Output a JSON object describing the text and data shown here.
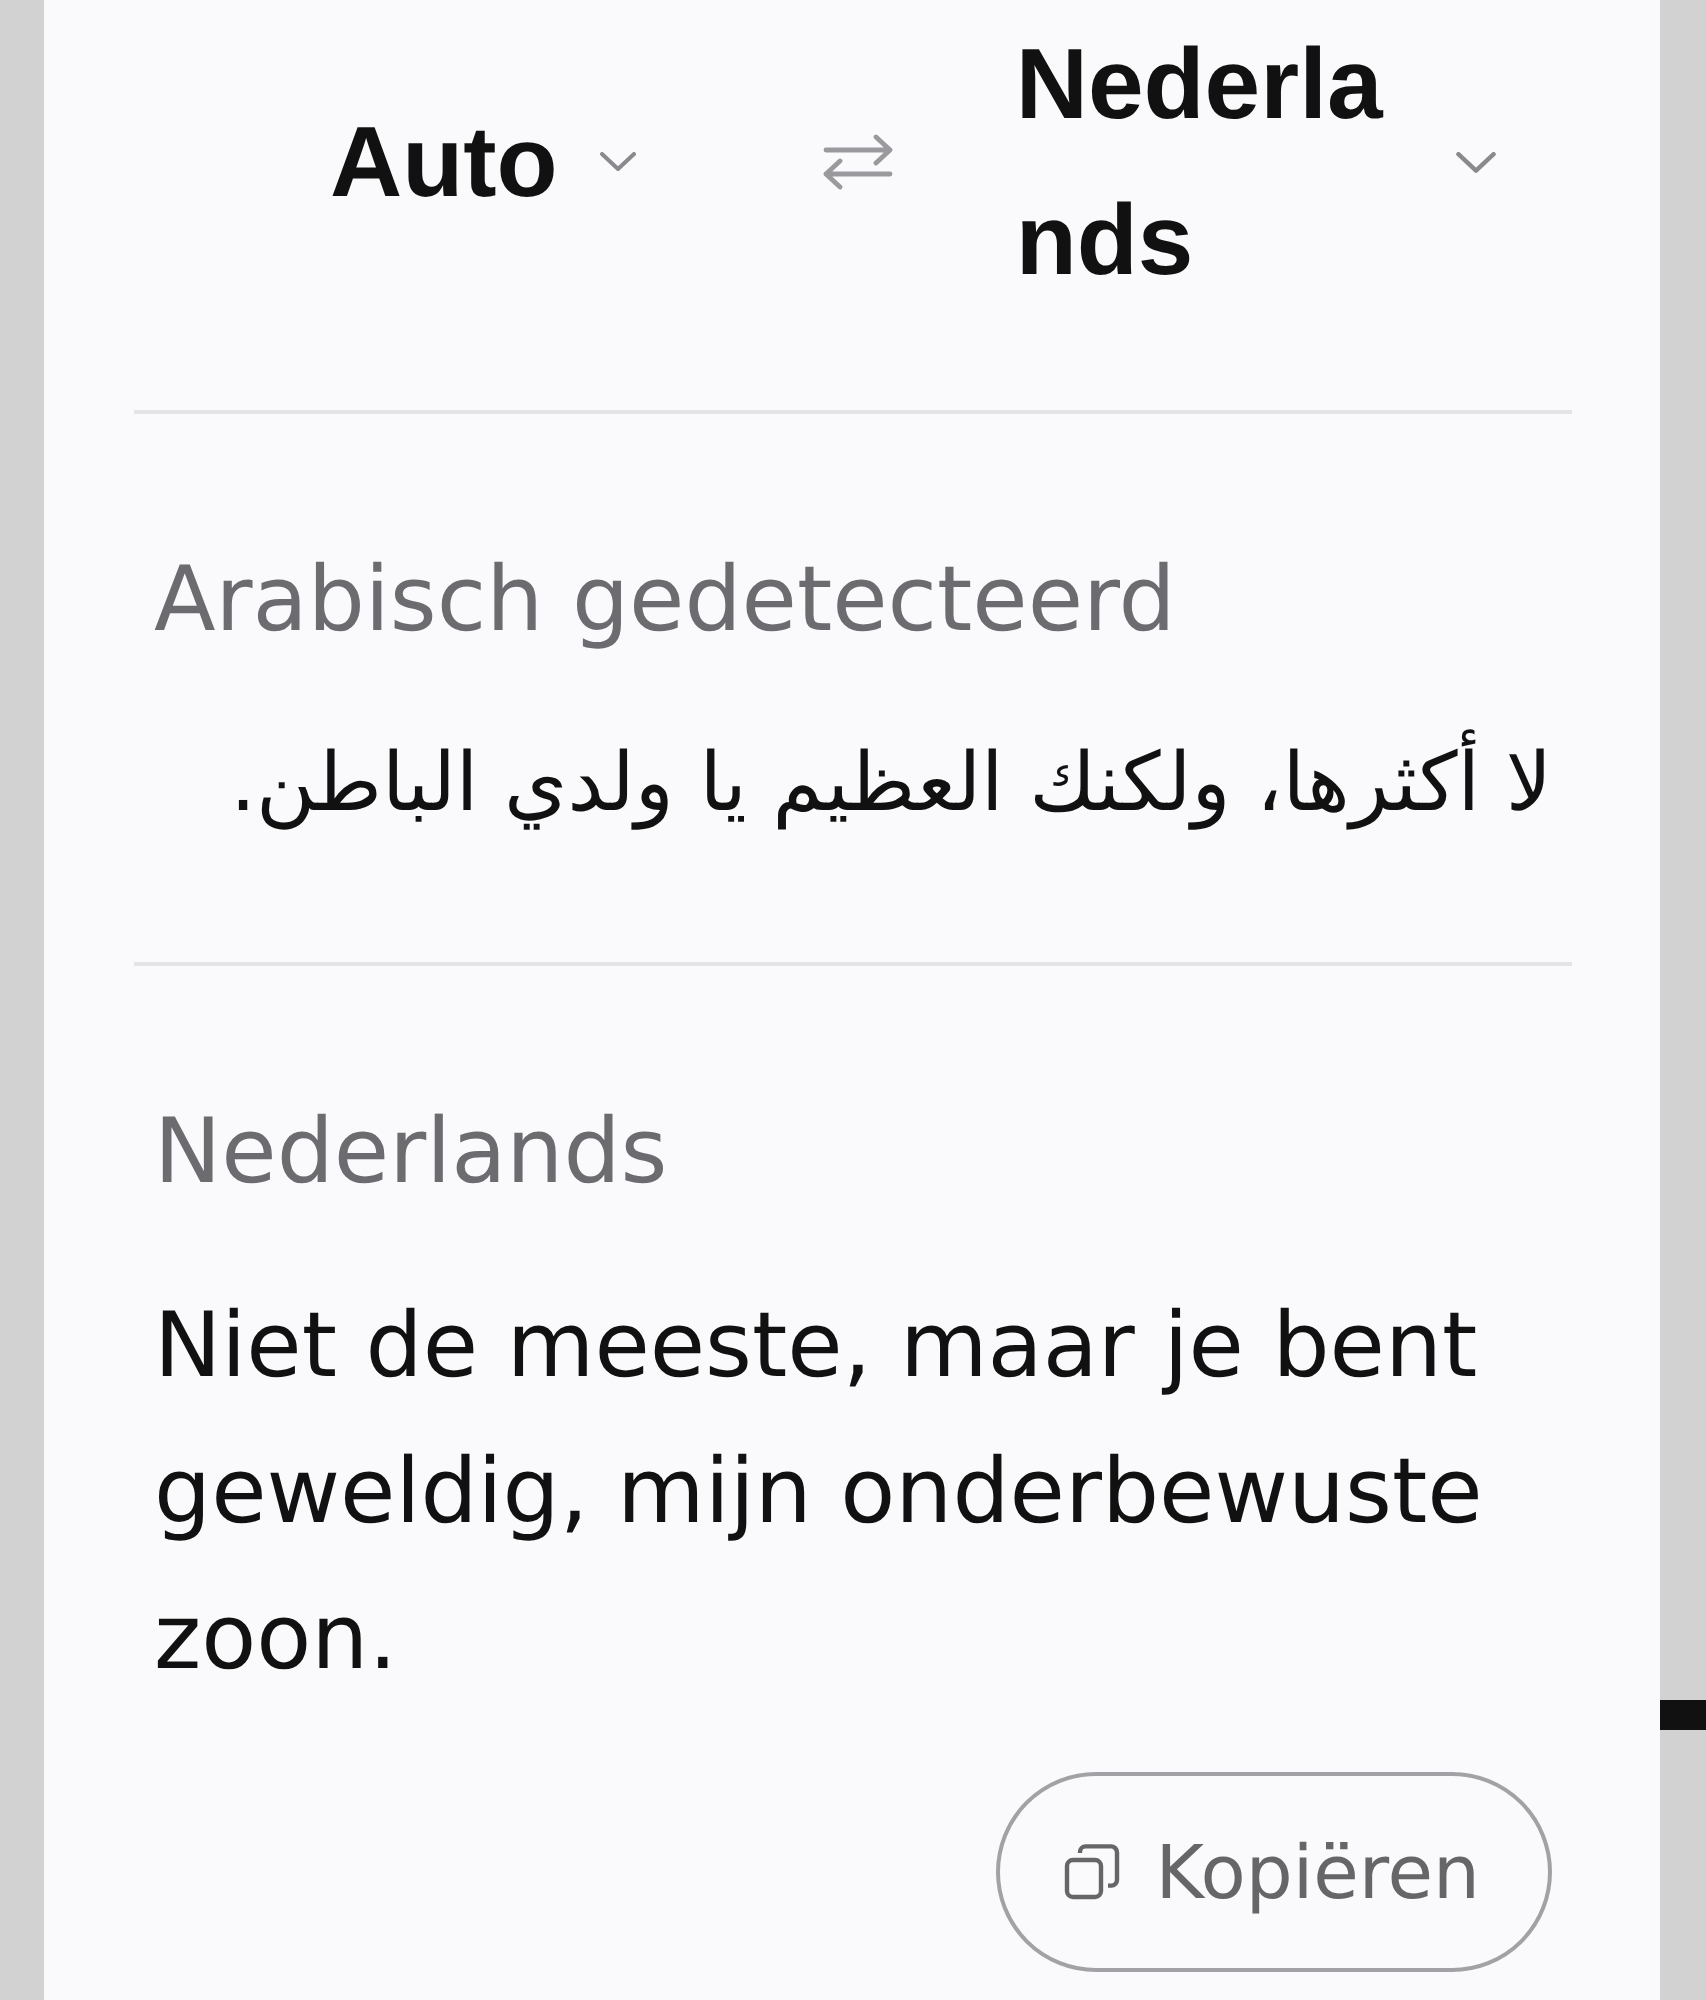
{
  "header": {
    "source_language": "Auto",
    "target_language": "Nederlands"
  },
  "detected": {
    "label": "Arabisch gedetecteerd",
    "text": "لا أكثرها، ولكنك العظيم يا ولدي الباطن."
  },
  "translation": {
    "label": "Nederlands",
    "text": "Niet de meeste, maar je bent geweldig, mijn onderbewuste zoon."
  },
  "copy_button": {
    "label": "Kopiëren"
  }
}
